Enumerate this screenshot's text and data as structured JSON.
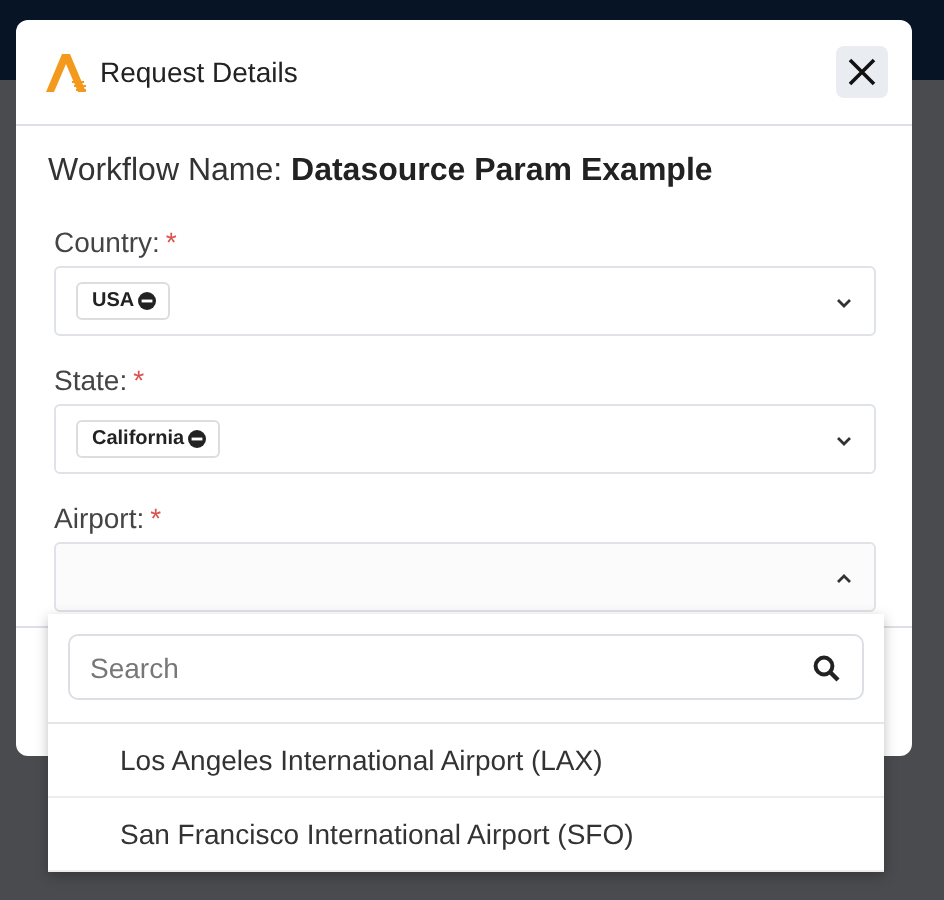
{
  "header": {
    "title": "Request Details"
  },
  "workflow": {
    "text": "Workflow Name: **Datasource Param Example**"
  },
  "fields": [
    {
      "label": "Country:",
      "required_mark": "*",
      "tags": [
        "USA"
      ],
      "expanded": false
    },
    {
      "label": "State:",
      "required_mark": "*",
      "tags": [
        "California"
      ],
      "expanded": false
    },
    {
      "label": "Airport:",
      "required_mark": "*",
      "expanded": true
    }
  ],
  "dropdown": {
    "search": {
      "placeholder": "Search"
    },
    "options": [
      {
        "label": "Los Angeles International Airport (LAX)",
        "selected": false
      },
      {
        "label": "San Francisco International Airport (SFO)",
        "selected": false
      }
    ]
  }
}
